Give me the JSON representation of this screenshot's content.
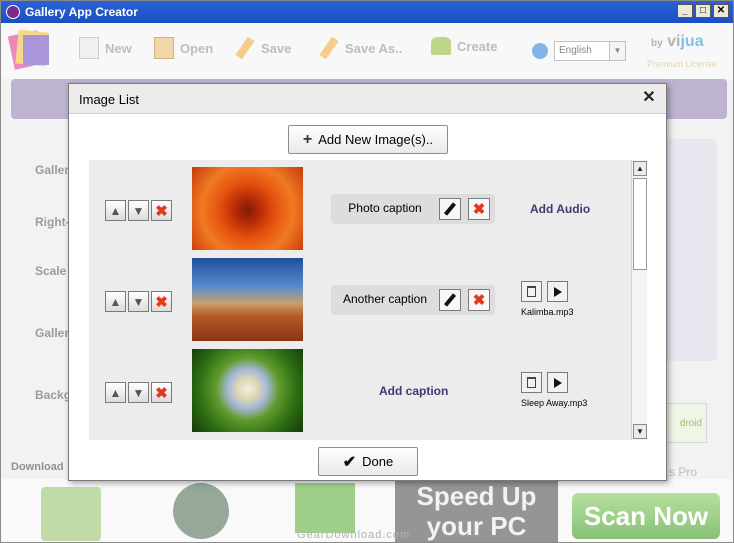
{
  "window": {
    "title": "Gallery App Creator",
    "controls": [
      "_",
      "□",
      "✕"
    ]
  },
  "toolbar": {
    "items": [
      {
        "label": "New",
        "icon": "new-document-icon"
      },
      {
        "label": "Open",
        "icon": "open-folder-icon"
      },
      {
        "label": "Save",
        "icon": "save-pen-icon"
      },
      {
        "label": "Save As..",
        "icon": "save-as-pen-icon"
      },
      {
        "label": "Create",
        "icon": "android-icon"
      }
    ],
    "language": "English",
    "brand_by": "by",
    "brand_vi": "vi",
    "brand_jua": "jua",
    "license": "Premium License"
  },
  "background": {
    "labels": [
      "Galler",
      "Right-",
      "Scale",
      "Galler",
      "Backg"
    ],
    "download": "Download",
    "android_btn": "droid",
    "partial_text": "s Pro",
    "ad": {
      "speed_line1": "Speed Up",
      "speed_line2": "your PC",
      "scan": "Scan Now"
    },
    "watermark": "GearDownload.com"
  },
  "dialog": {
    "title": "Image List",
    "close": "✕",
    "add_button": "Add New Image(s)..",
    "done_button": "Done",
    "rows": [
      {
        "caption": "Photo caption",
        "has_caption": true,
        "audio_link": "Add Audio",
        "audio_file": null
      },
      {
        "caption": "Another caption",
        "has_caption": true,
        "audio_link": null,
        "audio_file": "Kalimba.mp3"
      },
      {
        "caption": "Add caption",
        "has_caption": false,
        "audio_link": null,
        "audio_file": "Sleep Away.mp3"
      }
    ],
    "scroll": {
      "up": "▲",
      "down": "▼"
    }
  },
  "colors": {
    "titlebar": "#2a63d6",
    "link": "#3b3b72",
    "delete": "#e03a1a",
    "ad_green": "#4a9f2e"
  }
}
